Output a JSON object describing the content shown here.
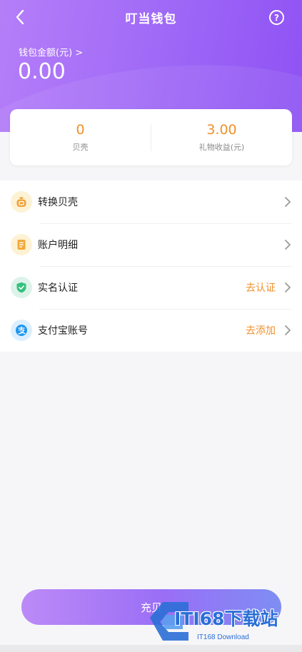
{
  "header": {
    "title": "叮当钱包",
    "help_icon_glyph": "?",
    "balance_label": "钱包金额(元) >",
    "balance_value": "0.00"
  },
  "stats": [
    {
      "value": "0",
      "label": "贝壳"
    },
    {
      "value": "3.00",
      "label": "礼物收益(元)"
    }
  ],
  "menu": [
    {
      "label": "转换贝壳",
      "action": "",
      "icon": "money-bag-icon",
      "icon_bg": "#fdf2d4",
      "icon_color": "#f0a23a"
    },
    {
      "label": "账户明细",
      "action": "",
      "icon": "document-icon",
      "icon_bg": "#fdf2d4",
      "icon_color": "#f2a93a"
    },
    {
      "label": "实名认证",
      "action": "去认证",
      "icon": "shield-check-icon",
      "icon_bg": "#ddf3ea",
      "icon_color": "#33c17c"
    },
    {
      "label": "支付宝账号",
      "action": "去添加",
      "icon": "alipay-icon",
      "icon_bg": "#dcefff",
      "icon_color": "#1e96f0"
    }
  ],
  "recharge_button": {
    "label": "充贝"
  },
  "watermark": {
    "brand": "ITI68下载站",
    "sub": "IT168 Download"
  },
  "colors": {
    "accent_orange": "#f0912b",
    "header_gradient_start": "#b57ef8",
    "header_gradient_end": "#8e52f4"
  }
}
